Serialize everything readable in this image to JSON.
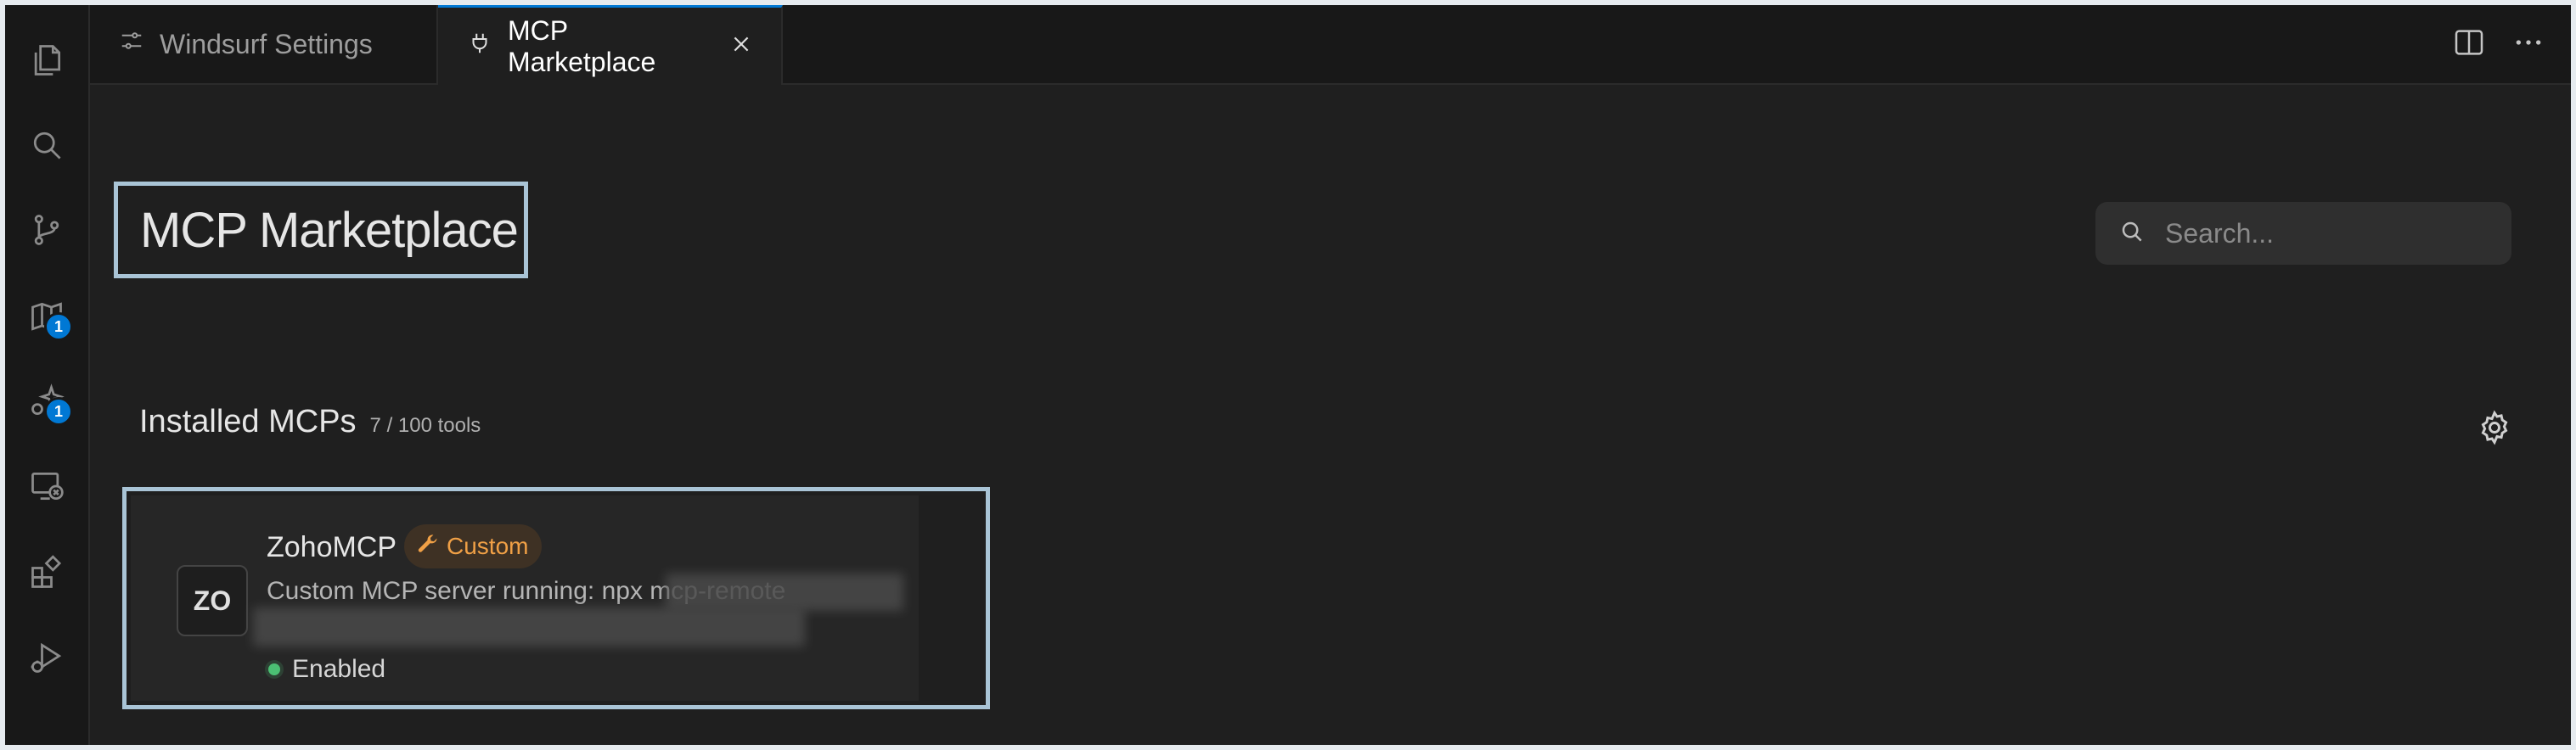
{
  "activity_bar": {
    "items": [
      {
        "icon": "files-icon"
      },
      {
        "icon": "search-icon"
      },
      {
        "icon": "source-control-icon"
      },
      {
        "icon": "map-icon",
        "badge": "1"
      },
      {
        "icon": "sparkle-icon",
        "badge": "1"
      },
      {
        "icon": "remote-explorer-icon"
      },
      {
        "icon": "extensions-icon"
      },
      {
        "icon": "run-debug-icon"
      }
    ]
  },
  "tabs": [
    {
      "label": "Windsurf Settings",
      "icon": "settings-sliders-icon",
      "active": false
    },
    {
      "label": "MCP Marketplace",
      "icon": "plug-icon",
      "active": true
    }
  ],
  "page": {
    "title": "MCP Marketplace",
    "search_placeholder": "Search..."
  },
  "installed": {
    "title": "Installed MCPs",
    "count": "7 / 100 tools"
  },
  "mcp_card": {
    "logo_text": "ZO",
    "name": "ZohoMCP",
    "tag": "Custom",
    "description": "Custom MCP server running: npx mcp-remote",
    "status": "Enabled"
  },
  "colors": {
    "accent": "#0078d4",
    "tag_text": "#f0a046",
    "enabled_dot": "#4bbf73",
    "highlight_outline": "#a9c4d6"
  }
}
